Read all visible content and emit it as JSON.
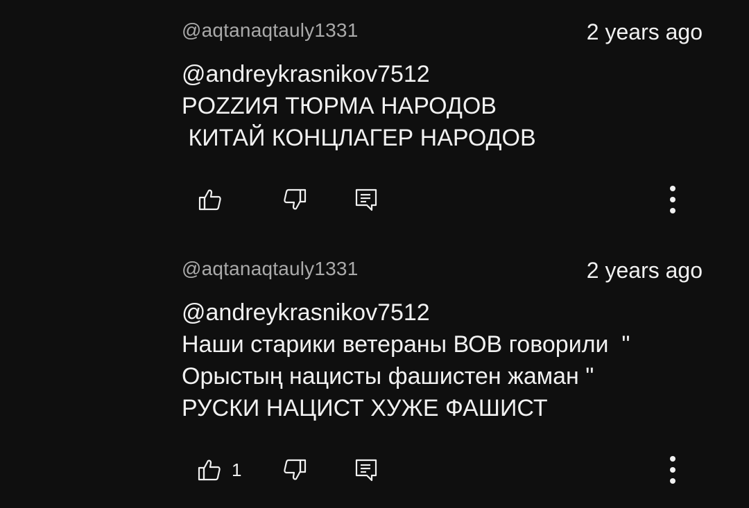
{
  "comments": [
    {
      "author": "@aqtanaqtauly1331",
      "time": "2 years ago",
      "text": "@andreykrasnikov7512\nPOZZИЯ ТЮРМА НАРОДОВ\n КИТАЙ КОНЦЛАГЕР НАРОДОВ",
      "like_count": ""
    },
    {
      "author": "@aqtanaqtauly1331",
      "time": "2 years ago",
      "text": "@andreykrasnikov7512\nНаши старики ветераны ВОВ говорили  \"\nОрыстың нацисты фашистен жаман \"\nРУСКИ НАЦИСТ ХУЖЕ ФАШИСТ",
      "like_count": "1"
    }
  ],
  "icons": {
    "like": "thumb-up-icon",
    "dislike": "thumb-down-icon",
    "reply": "reply-comment-icon",
    "more": "more-vertical-icon"
  },
  "colors": {
    "background": "#0f0f0f",
    "text": "#f1f1f1",
    "author": "#aaaaaa"
  }
}
